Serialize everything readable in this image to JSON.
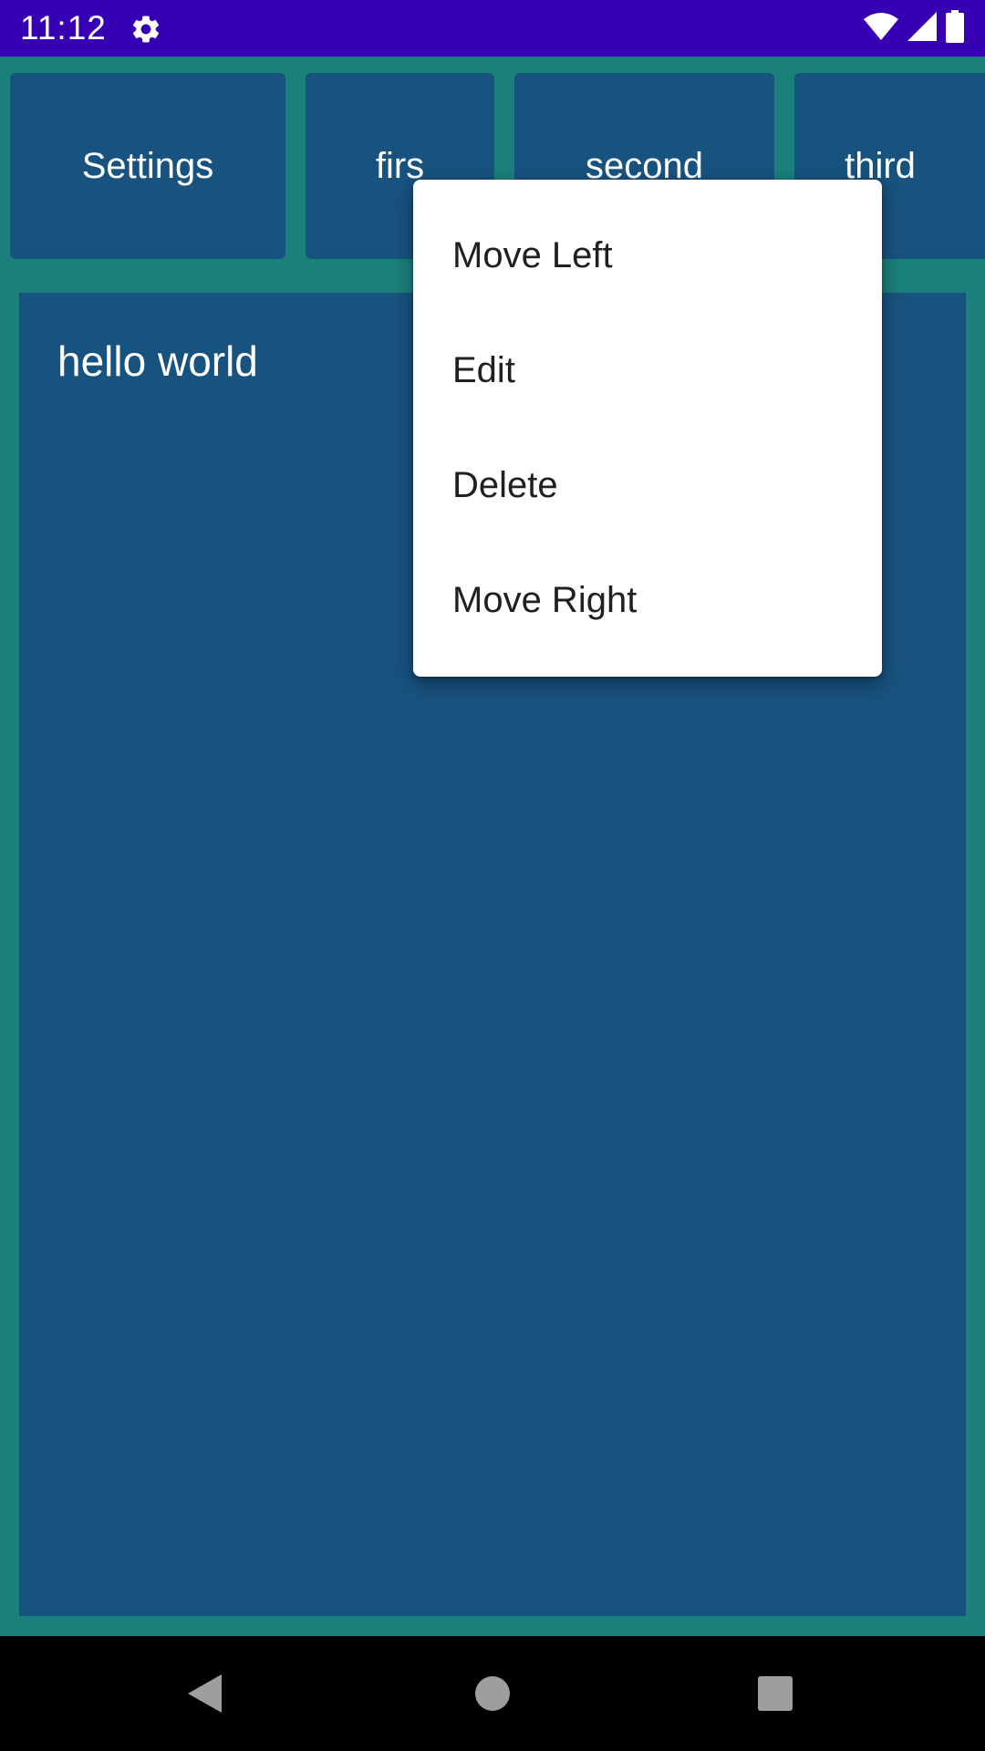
{
  "status_bar": {
    "time": "11:12",
    "icons": [
      "settings-gear-icon",
      "wifi-icon",
      "cell-signal-icon",
      "battery-icon"
    ]
  },
  "tabs": [
    {
      "label": "Settings"
    },
    {
      "label": "firs"
    },
    {
      "label": "second"
    },
    {
      "label": "third"
    }
  ],
  "content": {
    "text": "hello world"
  },
  "popup_menu": {
    "items": [
      {
        "label": "Move Left"
      },
      {
        "label": "Edit"
      },
      {
        "label": "Delete"
      },
      {
        "label": "Move Right"
      }
    ]
  },
  "nav_bar": {
    "buttons": [
      "back-icon",
      "home-icon",
      "recents-icon"
    ]
  },
  "colors": {
    "status_bar": "#3700b3",
    "background": "#1b7f7a",
    "card": "#18527f",
    "menu": "#ffffff",
    "nav_bar": "#000000"
  }
}
